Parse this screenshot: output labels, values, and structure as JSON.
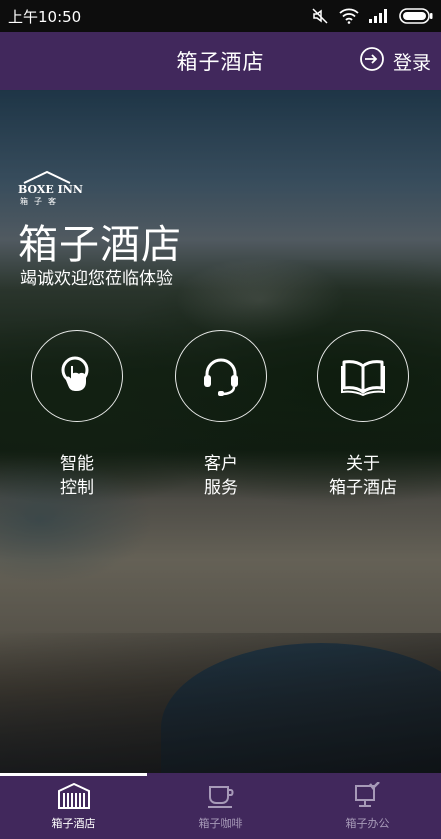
{
  "status_bar": {
    "time": "上午10:50",
    "icons": [
      "mute-icon",
      "wifi-icon",
      "signal-icon",
      "battery-icon"
    ]
  },
  "app_bar": {
    "title": "箱子酒店",
    "login_label": "登录",
    "login_icon": "login-arrow-icon",
    "color": "#41285c"
  },
  "brand": {
    "logo_text": "BOXE INN",
    "logo_sub": "箱子客",
    "name": "箱子酒店",
    "welcome": "竭诚欢迎您莅临体验"
  },
  "features": [
    {
      "icon": "touch-control-icon",
      "line1": "智能",
      "line2": "控制"
    },
    {
      "icon": "headset-icon",
      "line1": "客户",
      "line2": "服务"
    },
    {
      "icon": "book-icon",
      "line1": "关于",
      "line2": "箱子酒店"
    }
  ],
  "bottom_nav": {
    "items": [
      {
        "label": "箱子酒店",
        "icon": "hotel-building-icon",
        "active": true
      },
      {
        "label": "箱子咖啡",
        "icon": "coffee-cup-icon",
        "active": false
      },
      {
        "label": "箱子办公",
        "icon": "office-computer-icon",
        "active": false
      }
    ]
  }
}
